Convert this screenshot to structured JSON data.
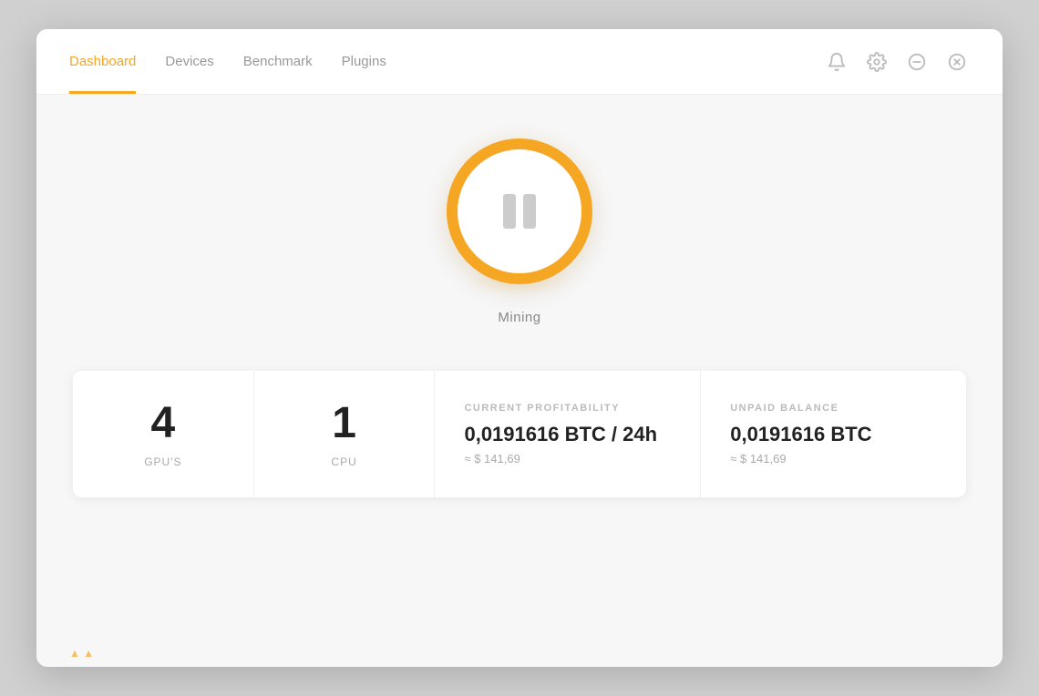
{
  "nav": {
    "tabs": [
      {
        "id": "dashboard",
        "label": "Dashboard",
        "active": true
      },
      {
        "id": "devices",
        "label": "Devices",
        "active": false
      },
      {
        "id": "benchmark",
        "label": "Benchmark",
        "active": false
      },
      {
        "id": "plugins",
        "label": "Plugins",
        "active": false
      }
    ]
  },
  "header_icons": {
    "notification": "🔔",
    "settings": "⚙",
    "minimize": "—",
    "close": "✕"
  },
  "mining": {
    "status_label": "Mining"
  },
  "stats": [
    {
      "type": "simple",
      "value": "4",
      "label": "GPU'S"
    },
    {
      "type": "simple",
      "value": "1",
      "label": "CPU"
    },
    {
      "type": "detail",
      "header": "CURRENT PROFITABILITY",
      "main": "0,0191616 BTC / 24h",
      "sub": "≈ $ 141,69"
    },
    {
      "type": "detail",
      "header": "UNPAID BALANCE",
      "main": "0,0191616 BTC",
      "sub": "≈ $ 141,69"
    }
  ],
  "colors": {
    "accent": "#f5a623",
    "text_dark": "#222",
    "text_muted": "#aaa",
    "text_label": "#bbb"
  }
}
